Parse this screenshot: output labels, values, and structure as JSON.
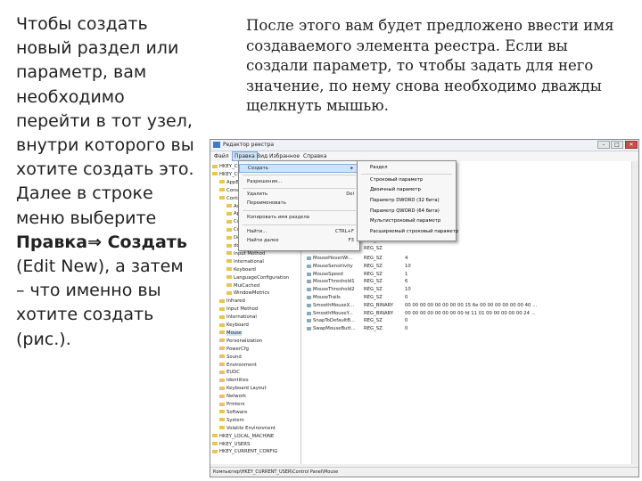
{
  "left_text": {
    "p1": "Чтобы создать новый раздел или параметр, вам необходимо перейти в тот узел, внутри которого вы хотите создать это. Далее в строке меню выберите",
    "bold1": "Правка⇒ Создать",
    "p2": " (Edit New), а затем – что именно вы хотите создать (рис.)."
  },
  "right_text": {
    "p1": "После этого вам будет предложено ввести имя создаваемого элемента реестра. Если вы создали параметр, то чтобы задать для него значение, по нему снова необходимо дважды щелкнуть мышью."
  },
  "window": {
    "title": "Редактор реестра",
    "menu": [
      "Файл",
      "Правка",
      "Вид",
      "Избранное",
      "Справка"
    ],
    "status": "Компьютер\\HKEY_CURRENT_USER\\Control Panel\\Mouse",
    "tree": [
      "HKEY_CLASSES_ROOT",
      "HKEY_CURRENT_USER",
      "AppEvents",
      "Console",
      "Control Panel",
      "Accessibility",
      "Appearance",
      "Colors",
      "Cursors",
      "Desktop",
      "don't load",
      "Input Method",
      "International",
      "Keyboard",
      "LanguageConfiguration",
      "MuiCached",
      "WindowMetrics",
      "Infrared",
      "Input Method",
      "International",
      "Keyboard",
      "Mouse",
      "Personalization",
      "PowerCfg",
      "Sound",
      "Environment",
      "EUDC",
      "Identities",
      "Keyboard Layout",
      "Network",
      "Printers",
      "Software",
      "System",
      "Volatile Environment",
      "HKEY_LOCAL_MACHINE",
      "HKEY_USERS",
      "HKEY_CURRENT_CONFIG"
    ],
    "values": [
      {
        "name": "MouseHoverWi...",
        "type": "REG_SZ",
        "data": "4"
      },
      {
        "name": "MouseSensitivity",
        "type": "REG_SZ",
        "data": "10"
      },
      {
        "name": "MouseSpeed",
        "type": "REG_SZ",
        "data": "1"
      },
      {
        "name": "MouseThreshold1",
        "type": "REG_SZ",
        "data": "6"
      },
      {
        "name": "MouseThreshold2",
        "type": "REG_SZ",
        "data": "10"
      },
      {
        "name": "MouseTrails",
        "type": "REG_SZ",
        "data": "0"
      },
      {
        "name": "SmoothMouseX...",
        "type": "REG_BINARY",
        "data": "00 00 00 00 00 00 00 00 15 6e 00 00 00 00 00 00 40 ..."
      },
      {
        "name": "SmoothMouseY...",
        "type": "REG_BINARY",
        "data": "00 00 00 00 00 00 00 00 fd 11 01 00 00 00 00 00 24 ..."
      },
      {
        "name": "SnapToDefaultB...",
        "type": "REG_SZ",
        "data": "0"
      },
      {
        "name": "SwapMouseButt...",
        "type": "REG_SZ",
        "data": "0"
      }
    ],
    "edit_menu": [
      {
        "label": "Создать",
        "shortcut": "▸"
      },
      {
        "label": "Разрешения...",
        "shortcut": ""
      },
      {
        "label": "Удалить",
        "shortcut": "Del"
      },
      {
        "label": "Переименовать",
        "shortcut": ""
      },
      {
        "label": "Копировать имя раздела",
        "shortcut": ""
      },
      {
        "label": "Найти...",
        "shortcut": "CTRL+F"
      },
      {
        "label": "Найти далее",
        "shortcut": "F3"
      }
    ],
    "submenu": [
      "Раздел",
      "Строковый параметр",
      "Двоичный параметр",
      "Параметр DWORD (32 бита)",
      "Параметр QWORD (64 бита)",
      "Мультистроковый параметр",
      "Расширяемый строковый параметр"
    ],
    "value_header_types": [
      "REG_SZ",
      "REG_SZ"
    ]
  }
}
